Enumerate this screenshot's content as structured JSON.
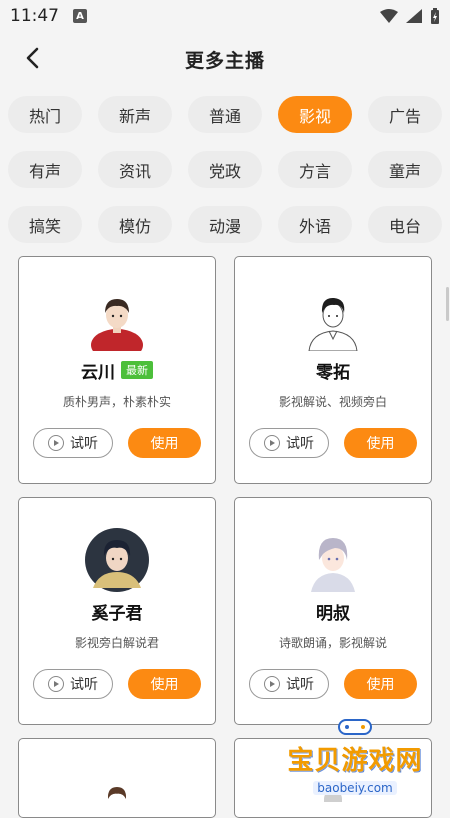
{
  "status": {
    "time": "11:47",
    "a_label": "A"
  },
  "header": {
    "title": "更多主播"
  },
  "tags": [
    {
      "label": "热门",
      "active": false
    },
    {
      "label": "新声",
      "active": false
    },
    {
      "label": "普通",
      "active": false
    },
    {
      "label": "影视",
      "active": true
    },
    {
      "label": "广告",
      "active": false
    },
    {
      "label": "有声",
      "active": false
    },
    {
      "label": "资讯",
      "active": false
    },
    {
      "label": "党政",
      "active": false
    },
    {
      "label": "方言",
      "active": false
    },
    {
      "label": "童声",
      "active": false
    },
    {
      "label": "搞笑",
      "active": false
    },
    {
      "label": "模仿",
      "active": false
    },
    {
      "label": "动漫",
      "active": false
    },
    {
      "label": "外语",
      "active": false
    },
    {
      "label": "电台",
      "active": false
    }
  ],
  "cards": [
    {
      "name": "云川",
      "badge": "最新",
      "desc": "质朴男声，朴素朴实",
      "try_label": "试听",
      "use_label": "使用"
    },
    {
      "name": "零拓",
      "badge": "",
      "desc": "影视解说、视频旁白",
      "try_label": "试听",
      "use_label": "使用"
    },
    {
      "name": "奚子君",
      "badge": "",
      "desc": "影视旁白解说君",
      "try_label": "试听",
      "use_label": "使用"
    },
    {
      "name": "明叔",
      "badge": "",
      "desc": "诗歌朗诵，影视解说",
      "try_label": "试听",
      "use_label": "使用"
    }
  ],
  "watermark": {
    "text": "宝贝游戏网",
    "url": "baobeiy.com"
  },
  "colors": {
    "accent": "#fc8a12",
    "badge": "#4cbf3a"
  }
}
